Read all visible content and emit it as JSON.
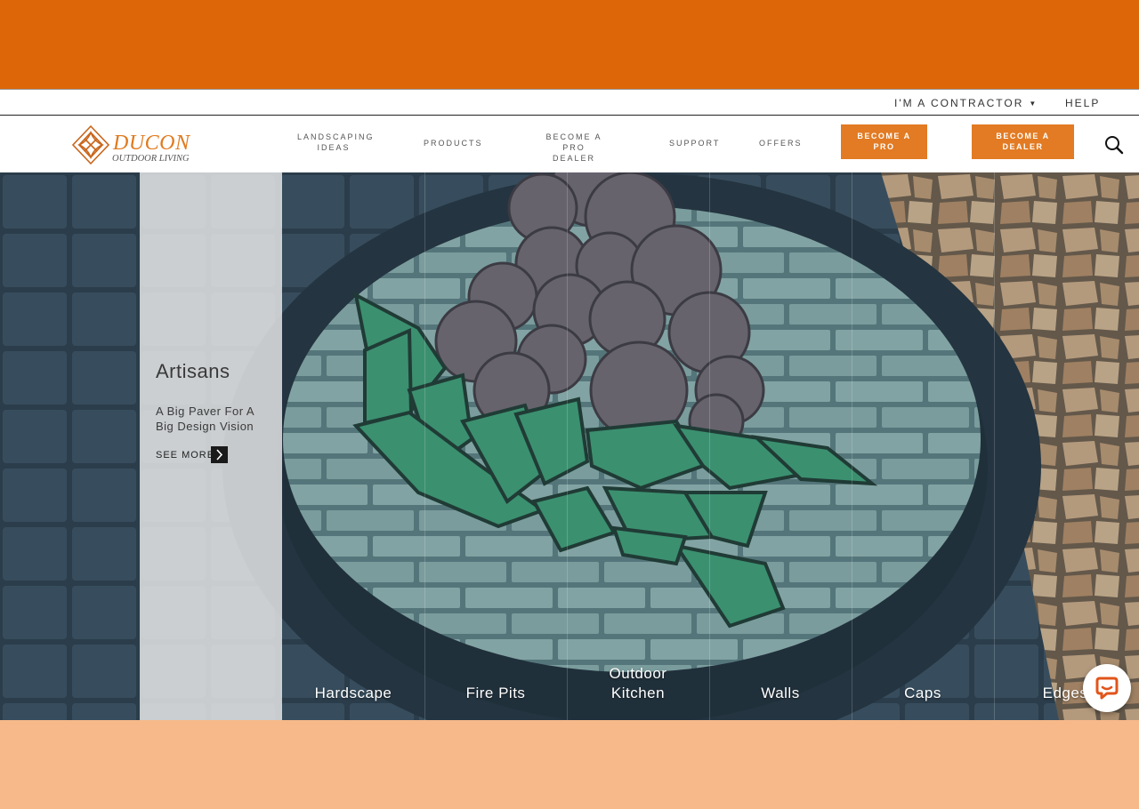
{
  "utility_bar": {
    "contractor_label": "I'M A CONTRACTOR",
    "help_label": "HELP"
  },
  "logo": {
    "brand": "DUCON",
    "tagline": "OUTDOOR LIVING"
  },
  "nav": {
    "items": [
      {
        "line1": "LANDSCAPING",
        "line2": "IDEAS"
      },
      {
        "line1": "PRODUCTS",
        "line2": ""
      },
      {
        "line1": "BECOME A PRO",
        "line2": "DEALER"
      },
      {
        "line1": "SUPPORT",
        "line2": ""
      },
      {
        "line1": "OFFERS",
        "line2": ""
      }
    ],
    "buttons": [
      {
        "line1": "BECOME A",
        "line2": "PRO"
      },
      {
        "line1": "BECOME A",
        "line2": "DEALER"
      }
    ]
  },
  "hero": {
    "title": "Artisans",
    "description": "A Big Paver For A Big Design Vision",
    "see_more": "SEE MORE",
    "categories": [
      {
        "line1": "Hardscape",
        "line2": ""
      },
      {
        "line1": "Fire Pits",
        "line2": ""
      },
      {
        "line1": "Outdoor",
        "line2": "Kitchen"
      },
      {
        "line1": "Walls",
        "line2": ""
      },
      {
        "line1": "Caps",
        "line2": ""
      },
      {
        "line1": "Edges",
        "line2": ""
      }
    ]
  },
  "icons": {
    "search": "search-icon",
    "chat": "chat-icon",
    "arrow": "chevron-right-icon",
    "caret": "caret-down-icon"
  },
  "colors": {
    "brand_orange": "#dc6608",
    "button_orange": "#e27b23",
    "peach": "#f7b98a"
  }
}
